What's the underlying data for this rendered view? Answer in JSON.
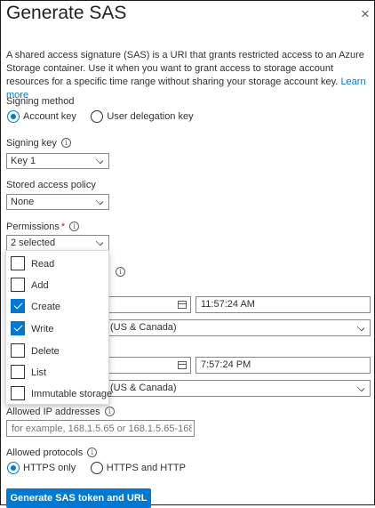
{
  "panel": {
    "title": "Generate SAS",
    "close_glyph": "×",
    "description": "A shared access signature (SAS) is a URI that grants restricted access to an Azure Storage container. Use it when you want to grant access to storage account resources for a specific time range without sharing your storage account key.",
    "learn_more": "Learn more"
  },
  "signing_method": {
    "label": "Signing method",
    "options": [
      "Account key",
      "User delegation key"
    ],
    "selected": "Account key"
  },
  "signing_key": {
    "label": "Signing key",
    "value": "Key 1"
  },
  "stored_policy": {
    "label": "Stored access policy",
    "value": "None"
  },
  "permissions": {
    "label": "Permissions",
    "required_mark": "*",
    "value": "2 selected",
    "items": [
      {
        "label": "Read",
        "checked": false
      },
      {
        "label": "Add",
        "checked": false
      },
      {
        "label": "Create",
        "checked": true
      },
      {
        "label": "Write",
        "checked": true
      },
      {
        "label": "Delete",
        "checked": false
      },
      {
        "label": "List",
        "checked": false
      },
      {
        "label": "Immutable storage",
        "checked": false
      }
    ]
  },
  "start": {
    "time": "11:57:24 AM",
    "timezone": "(US & Canada)"
  },
  "expiry": {
    "time": "7:57:24 PM",
    "timezone": "(US & Canada)"
  },
  "ip": {
    "label": "Allowed IP addresses",
    "placeholder": "for example, 168.1.5.65 or 168.1.5.65-168.1...."
  },
  "protocols": {
    "label": "Allowed protocols",
    "options": [
      "HTTPS only",
      "HTTPS and HTTP"
    ],
    "selected": "HTTPS only"
  },
  "generate_button": "Generate SAS token and URL",
  "colors": {
    "accent": "#0078d4",
    "required": "#a4262c"
  }
}
